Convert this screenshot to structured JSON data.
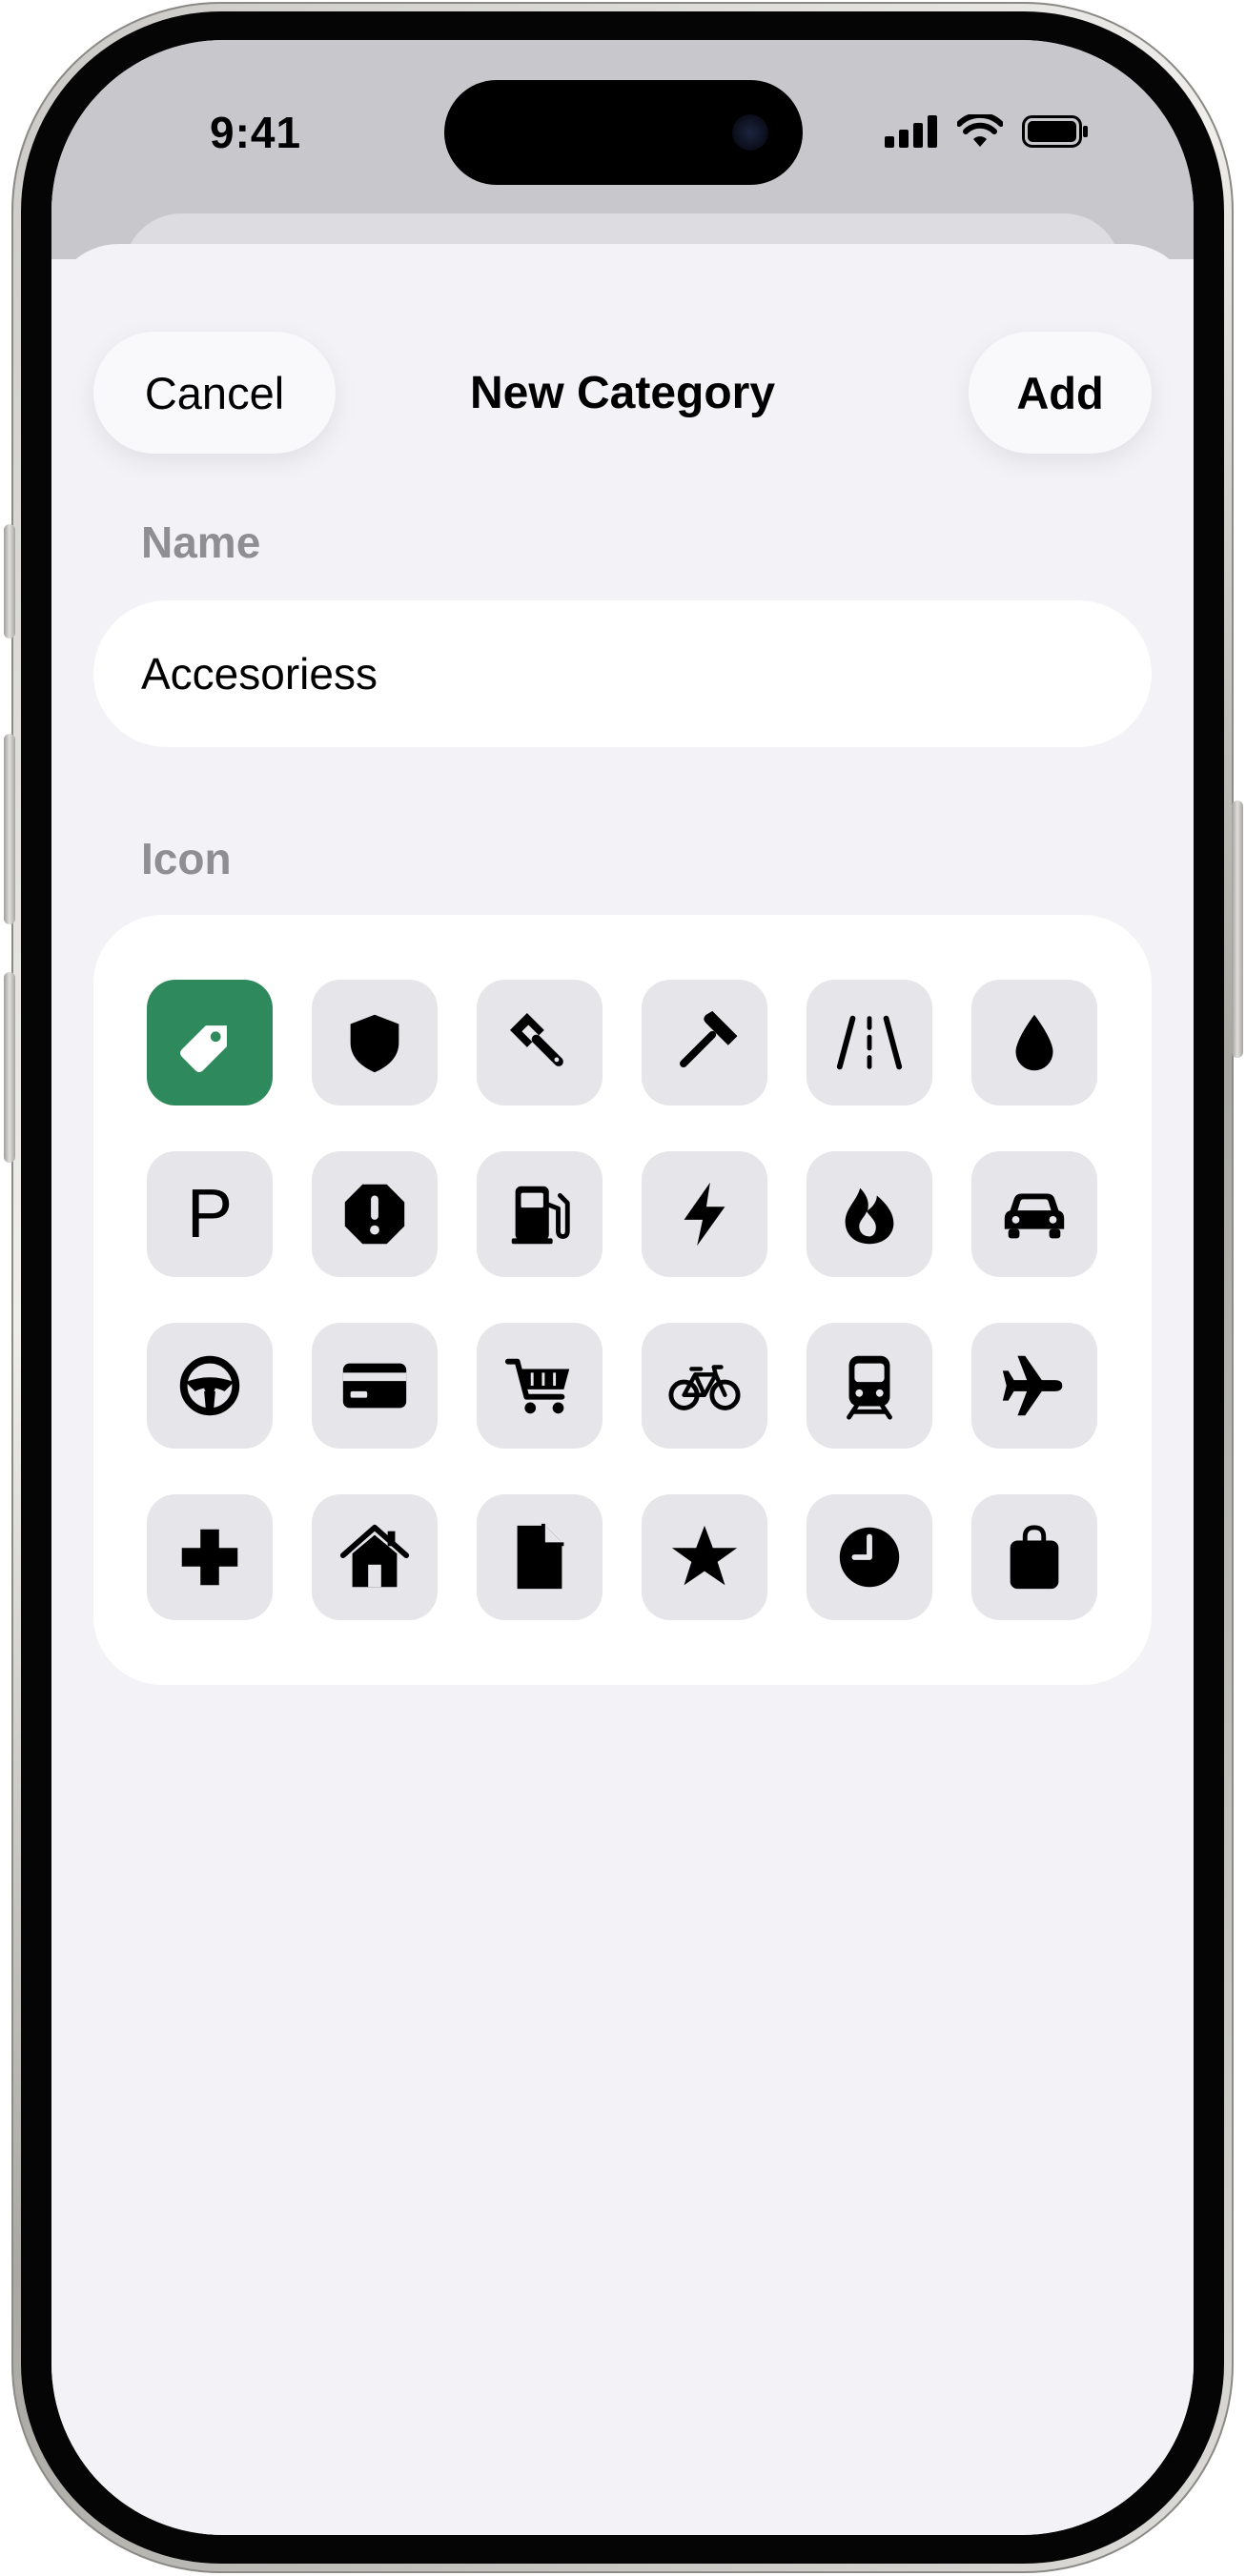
{
  "status_bar": {
    "time": "9:41"
  },
  "sheet": {
    "title": "New Category",
    "cancel_label": "Cancel",
    "add_label": "Add"
  },
  "name_section": {
    "label": "Name",
    "value": "Accesoriess"
  },
  "icon_section": {
    "label": "Icon",
    "selected_icon": "tag",
    "selected_color": "#2e8a5c",
    "icons": [
      "tag",
      "shield",
      "wrench",
      "hammer",
      "road-lanes",
      "drop",
      "parking",
      "warning-octagon",
      "fuel-pump",
      "bolt",
      "flame",
      "car",
      "steering-wheel",
      "credit-card",
      "shopping-cart",
      "bicycle",
      "tram",
      "airplane",
      "cross",
      "house",
      "document",
      "star",
      "clock",
      "shopping-bag"
    ],
    "parking_glyph": "P"
  }
}
